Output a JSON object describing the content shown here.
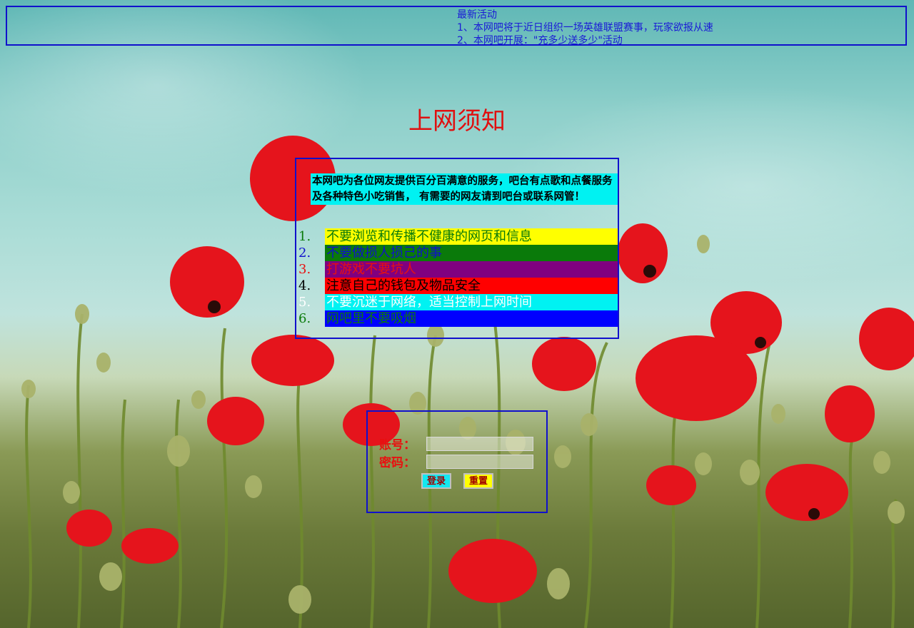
{
  "notice": {
    "title": "最新活动",
    "items": [
      "1、本网吧将于近日组织一场英雄联盟赛事，玩家欲报从速",
      "2、本网吧开展：\"充多少送多少\"活动"
    ]
  },
  "page_title": "上网须知",
  "intro": "本网吧为各位网友提供百分百满意的服务，吧台有点歌和点餐服务及各种特色小吃销售， 有需要的网友请到吧台或联系网管！",
  "rules": [
    {
      "num": "1.",
      "text": "不要浏览和传播不健康的网页和信息",
      "num_color": "#0a7a0a",
      "bg": "#ffff00",
      "color": "#0a7a0a"
    },
    {
      "num": "2.",
      "text": "不要做损人损己的事",
      "num_color": "#1010cc",
      "bg": "#0a7a0a",
      "color": "#1010cc"
    },
    {
      "num": "3.",
      "text": "打游戏不要坑人",
      "num_color": "#e81010",
      "bg": "#800080",
      "color": "#e81010"
    },
    {
      "num": "4.",
      "text": "注意自己的钱包及物品安全",
      "num_color": "#000000",
      "bg": "#ff0000",
      "color": "#000000"
    },
    {
      "num": "5.",
      "text": "不要沉迷于网络，适当控制上网时间",
      "num_color": "#ffffff",
      "bg": "#00f2f2",
      "color": "#ffffff"
    },
    {
      "num": "6.",
      "text": "网吧里不要吸烟",
      "num_color": "#0a7a0a",
      "bg": "#0000ff",
      "color": "#0a7a0a"
    }
  ],
  "login": {
    "account_label": "账号：",
    "password_label": "密码：",
    "account_value": "",
    "password_value": "",
    "login_button": "登录",
    "reset_button": "重置"
  },
  "colors": {
    "border": "#1010cc",
    "title": "#e01010",
    "notice_text": "#1a1ad6",
    "intro_bg": "#00f2f2"
  },
  "icons": [
    "poppy-field-background"
  ]
}
